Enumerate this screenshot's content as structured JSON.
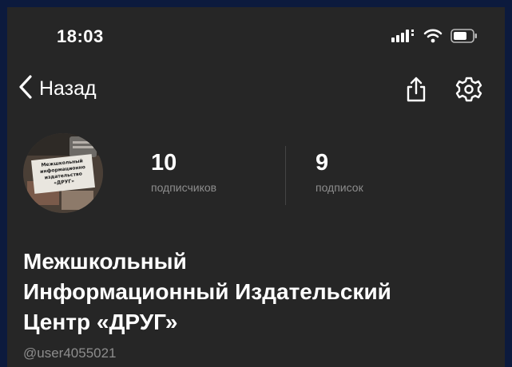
{
  "status_bar": {
    "time": "18:03",
    "icons": [
      "cellular-signal-icon",
      "wifi-icon",
      "battery-icon"
    ]
  },
  "nav": {
    "back_label": "Назад",
    "actions": [
      "share-icon",
      "gear-icon"
    ]
  },
  "profile": {
    "avatar_text": [
      "Межшкольный",
      "информационно",
      "издательство",
      "«ДРУГ»"
    ],
    "stats": [
      {
        "value": "10",
        "label": "подписчиков"
      },
      {
        "value": "9",
        "label": "подписок"
      }
    ],
    "name_lines": [
      "Межшкольный",
      "Информационный Издательский",
      "Центр «ДРУГ»"
    ],
    "username": "@user4055021"
  },
  "colors": {
    "background": "#262626",
    "outer_frame": "#0c1a3d",
    "text_primary": "#ffffff",
    "text_secondary": "#8d8d8d"
  }
}
